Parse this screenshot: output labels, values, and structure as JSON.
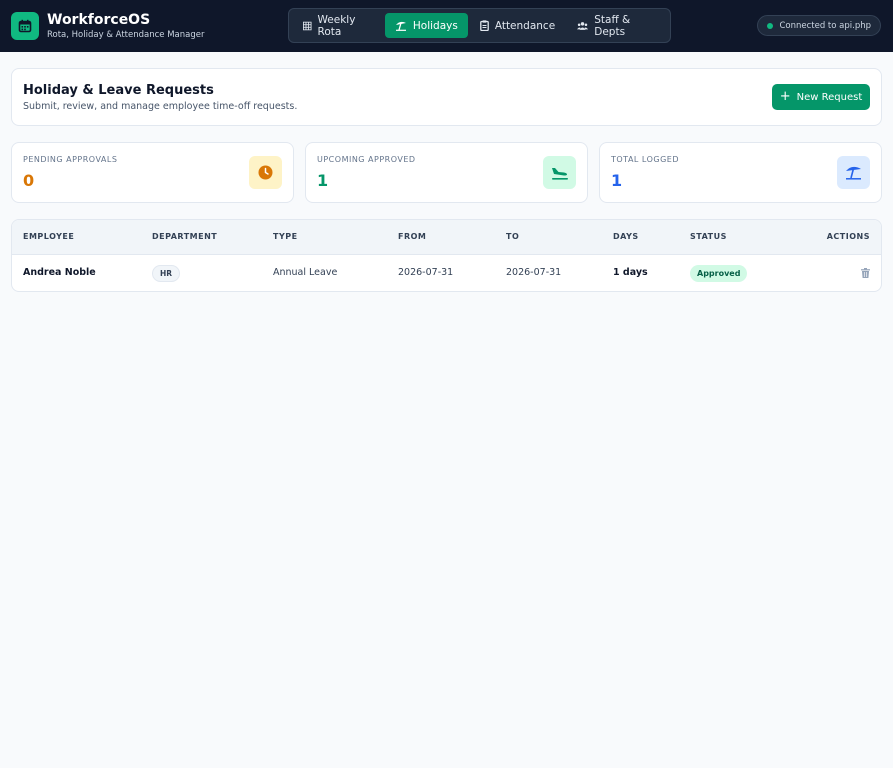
{
  "brand": {
    "title": "WorkforceOS",
    "subtitle": "Rota, Holiday & Attendance Manager",
    "icon": "calendar-icon",
    "color": "#10b981"
  },
  "nav": {
    "tabs": [
      {
        "label": "Weekly Rota",
        "icon": "table-icon",
        "active": false
      },
      {
        "label": "Holidays",
        "icon": "umbrella-beach-icon",
        "active": true
      },
      {
        "label": "Attendance",
        "icon": "clipboard-icon",
        "active": false
      },
      {
        "label": "Staff & Depts",
        "icon": "users-icon",
        "active": false
      }
    ]
  },
  "connection": {
    "text": "Connected to api.php",
    "status_color": "#10b981"
  },
  "page": {
    "title": "Holiday & Leave Requests",
    "subtitle": "Submit, review, and manage employee time-off requests.",
    "new_button": "New Request"
  },
  "stats": [
    {
      "label": "Pending Approvals",
      "value": "0",
      "color": "#d97706",
      "icon": "clock-icon"
    },
    {
      "label": "Upcoming Approved",
      "value": "1",
      "color": "#059669",
      "icon": "plane-landing-icon"
    },
    {
      "label": "Total Logged",
      "value": "1",
      "color": "#2563eb",
      "icon": "umbrella-beach-icon"
    }
  ],
  "table": {
    "columns": [
      "EMPLOYEE",
      "DEPARTMENT",
      "TYPE",
      "FROM",
      "TO",
      "DAYS",
      "STATUS",
      "ACTIONS"
    ],
    "rows": [
      {
        "employee": "Andrea Noble",
        "department": "HR",
        "type": "Annual Leave",
        "from": "2026-07-31",
        "to": "2026-07-31",
        "days": "1 days",
        "status": "Approved"
      }
    ]
  },
  "colors": {
    "header_bg": "#0f172a",
    "accent": "#059669",
    "page_bg": "#f8fafc"
  }
}
